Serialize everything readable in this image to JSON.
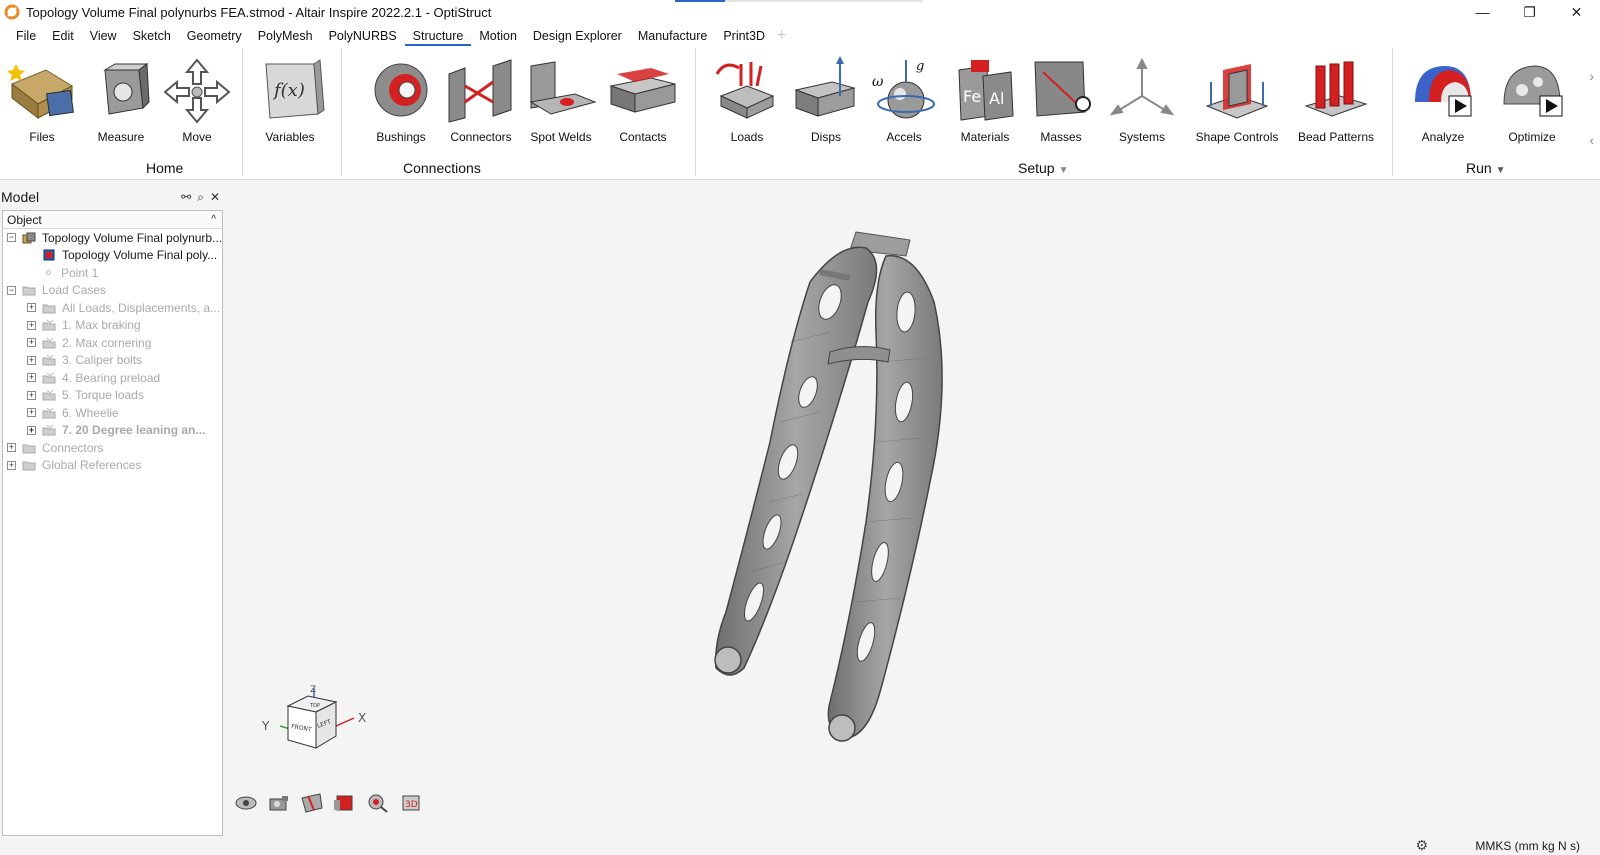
{
  "window": {
    "title": "Topology Volume Final polynurbs FEA.stmod - Altair Inspire 2022.2.1 - OptiStruct",
    "minimize": "—",
    "maximize": "❐",
    "close": "✕"
  },
  "menu": {
    "items": [
      "File",
      "Edit",
      "View",
      "Sketch",
      "Geometry",
      "PolyMesh",
      "PolyNURBS",
      "Structure",
      "Motion",
      "Design Explorer",
      "Manufacture",
      "Print3D"
    ],
    "active": "Structure",
    "plus": "+"
  },
  "ribbon": {
    "home": {
      "label": "Home",
      "tools": [
        "Files",
        "Measure",
        "Move"
      ]
    },
    "variables": {
      "tools": [
        "Variables"
      ]
    },
    "connections": {
      "label": "Connections",
      "tools": [
        "Bushings",
        "Connectors",
        "Spot Welds",
        "Contacts"
      ]
    },
    "setup": {
      "label": "Setup",
      "tools": [
        "Loads",
        "Disps",
        "Accels",
        "Materials",
        "Masses",
        "Systems",
        "Shape Controls",
        "Bead Patterns"
      ]
    },
    "run": {
      "label": "Run",
      "tools": [
        "Analyze",
        "Optimize"
      ]
    },
    "dropdown_glyph": "▼",
    "scroll_right": "›",
    "scroll_left": "‹"
  },
  "model_panel": {
    "title": "Model",
    "column_header": "Object",
    "tree": [
      {
        "label": "Topology Volume Final polynurb...",
        "style": "normal",
        "expander": "−",
        "indent": 0,
        "icon": "assembly-icon"
      },
      {
        "label": "Topology Volume Final poly...",
        "style": "normal",
        "expander": "",
        "indent": 1,
        "icon": "part-icon"
      },
      {
        "label": "Point 1",
        "style": "dim",
        "expander": "",
        "indent": 1,
        "icon": "point-icon"
      },
      {
        "label": "Load Cases",
        "style": "dim",
        "expander": "−",
        "indent": 0,
        "icon": "folder-icon"
      },
      {
        "label": "All Loads, Displacements, a...",
        "style": "dim",
        "expander": "+",
        "indent": 1,
        "icon": "folder-icon"
      },
      {
        "label": "1. Max braking",
        "style": "dim",
        "expander": "+",
        "indent": 1,
        "icon": "loadcase-icon"
      },
      {
        "label": "2. Max cornering",
        "style": "dim",
        "expander": "+",
        "indent": 1,
        "icon": "loadcase-icon"
      },
      {
        "label": "3. Caliper bolts",
        "style": "dim",
        "expander": "+",
        "indent": 1,
        "icon": "loadcase-icon"
      },
      {
        "label": "4. Bearing preload",
        "style": "dim",
        "expander": "+",
        "indent": 1,
        "icon": "loadcase-icon"
      },
      {
        "label": "5. Torque loads",
        "style": "dim",
        "expander": "+",
        "indent": 1,
        "icon": "loadcase-icon"
      },
      {
        "label": "6. Wheelie",
        "style": "dim",
        "expander": "+",
        "indent": 1,
        "icon": "loadcase-icon"
      },
      {
        "label": "7. 20 Degree leaning an...",
        "style": "dim-bold",
        "expander": "+",
        "indent": 1,
        "icon": "loadcase-icon"
      },
      {
        "label": "Connectors",
        "style": "dim",
        "expander": "+",
        "indent": 0,
        "icon": "folder-icon"
      },
      {
        "label": "Global References",
        "style": "dim",
        "expander": "+",
        "indent": 0,
        "icon": "folder-icon"
      }
    ]
  },
  "viewcube": {
    "top": "TOP",
    "front": "FRONT",
    "left": "LEFT",
    "axis_x": "X",
    "axis_y": "Y",
    "axis_z": "Z"
  },
  "status": {
    "units": "MMKS (mm kg N s)"
  },
  "colors": {
    "accent": "#2a64c8",
    "model_gray": "#8d8d8d",
    "red": "#d42020"
  }
}
